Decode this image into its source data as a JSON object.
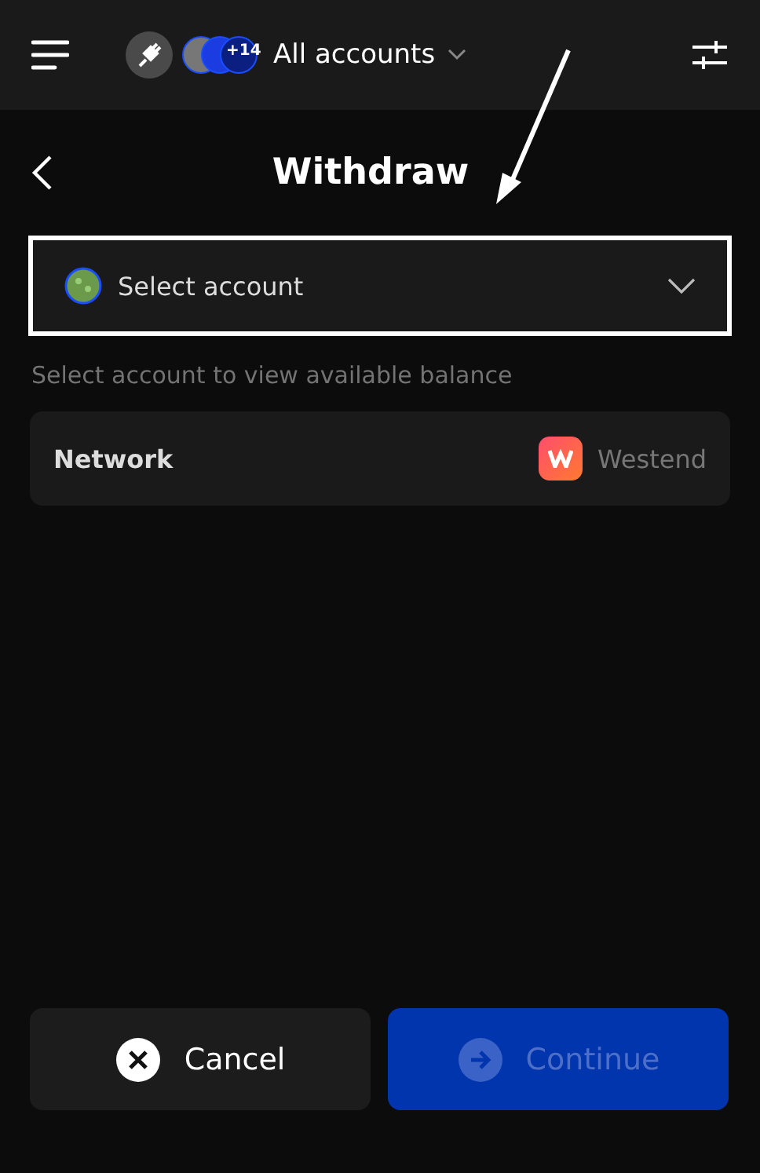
{
  "header": {
    "accounts_label": "All accounts",
    "more_count": "+14"
  },
  "page": {
    "title": "Withdraw"
  },
  "account_select": {
    "placeholder": "Select account",
    "highlighted": true
  },
  "hint": "Select account to view available balance",
  "network": {
    "label": "Network",
    "value": "Westend"
  },
  "buttons": [
    {
      "kind": "cancel",
      "label": "Cancel",
      "disabled": false
    },
    {
      "kind": "continue",
      "label": "Continue",
      "disabled": true
    }
  ]
}
